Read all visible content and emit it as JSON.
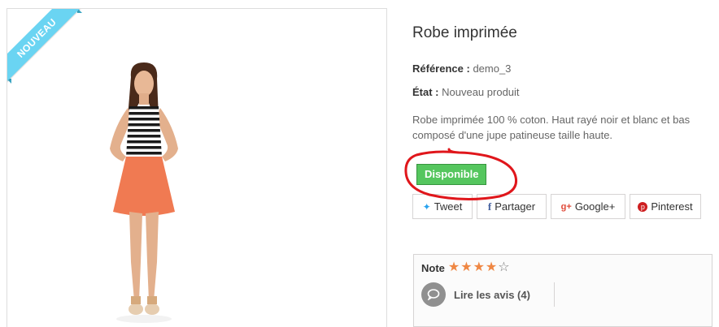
{
  "badge": {
    "label": "NOUVEAU",
    "color": "#6ad4f2"
  },
  "product": {
    "title": "Robe imprimée",
    "reference_label": "Référence :",
    "reference_value": "demo_3",
    "condition_label": "État :",
    "condition_value": "Nouveau produit",
    "description": "Robe imprimée 100 % coton. Haut rayé noir et blanc et bas composé d'une jupe patineuse taille haute.",
    "availability": "Disponible",
    "availability_color": "#55c65e"
  },
  "social": [
    {
      "label": "Tweet",
      "icon": "twitter-icon"
    },
    {
      "label": "Partager",
      "icon": "facebook-icon"
    },
    {
      "label": "Google+",
      "icon": "google-plus-icon"
    },
    {
      "label": "Pinterest",
      "icon": "pinterest-icon"
    }
  ],
  "reviews": {
    "note_label": "Note",
    "rating": 4,
    "max_rating": 5,
    "read_label": "Lire les avis (4)"
  },
  "annotation": {
    "color": "#e0161b"
  }
}
